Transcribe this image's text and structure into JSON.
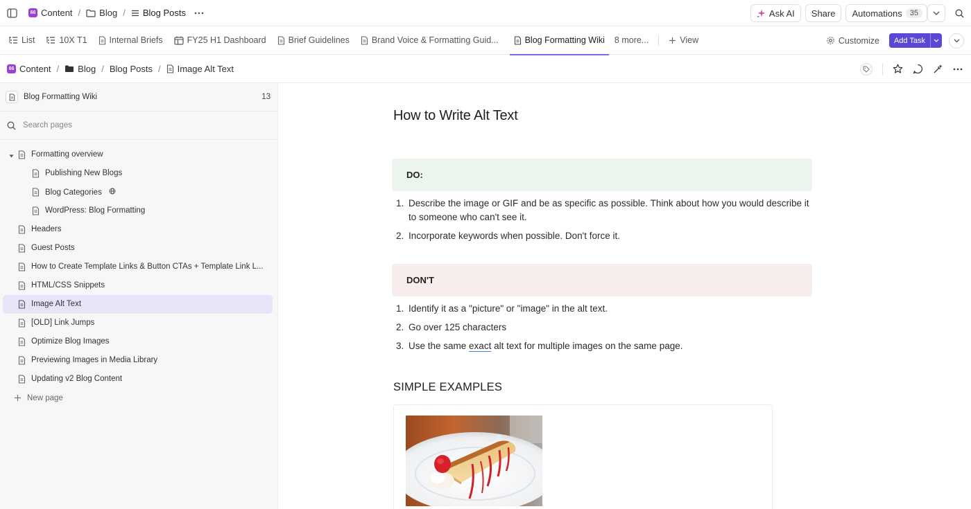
{
  "topbar": {
    "breadcrumb": [
      {
        "label": "Content",
        "icon": "workspace-badge"
      },
      {
        "label": "Blog",
        "icon": "folder-icon"
      },
      {
        "label": "Blog Posts",
        "icon": "list-icon"
      }
    ],
    "ask_ai": "Ask AI",
    "share": "Share",
    "automations": "Automations",
    "automations_count": "35"
  },
  "views": {
    "tabs": [
      {
        "label": "List",
        "icon": "list-view-icon"
      },
      {
        "label": "10X T1",
        "icon": "list-view-icon"
      },
      {
        "label": "Internal Briefs",
        "icon": "doc-icon"
      },
      {
        "label": "FY25 H1 Dashboard",
        "icon": "dashboard-icon"
      },
      {
        "label": "Brief Guidelines",
        "icon": "doc-icon"
      },
      {
        "label": "Brand Voice & Formatting Guid...",
        "icon": "doc-icon"
      },
      {
        "label": "Blog Formatting Wiki",
        "icon": "doc-icon",
        "active": true
      }
    ],
    "more": "8 more...",
    "add_view": "View",
    "customize": "Customize",
    "add_task": "Add Task"
  },
  "page_breadcrumb": {
    "workspace": "Content",
    "folder": "Blog",
    "list": "Blog Posts",
    "page": "Image Alt Text"
  },
  "sidebar": {
    "title": "Blog Formatting Wiki",
    "count": "13",
    "search_placeholder": "Search pages",
    "items": [
      {
        "label": "Formatting overview",
        "level": 0,
        "expanded": true
      },
      {
        "label": "Publishing New Blogs",
        "level": 1
      },
      {
        "label": "Blog Categories",
        "level": 1,
        "globe": true
      },
      {
        "label": "WordPress: Blog Formatting",
        "level": 1
      },
      {
        "label": "Headers",
        "level": 0
      },
      {
        "label": "Guest Posts",
        "level": 0
      },
      {
        "label": "How to Create Template Links & Button CTAs + Template Link L...",
        "level": 0
      },
      {
        "label": "HTML/CSS Snippets",
        "level": 0
      },
      {
        "label": "Image Alt Text",
        "level": 0,
        "active": true
      },
      {
        "label": "[OLD] Link Jumps",
        "level": 0
      },
      {
        "label": "Optimize Blog Images",
        "level": 0
      },
      {
        "label": "Previewing Images in Media Library",
        "level": 0
      },
      {
        "label": "Updating v2 Blog Content",
        "level": 0
      }
    ],
    "new_page": "New page"
  },
  "doc": {
    "title": "How to Write Alt Text",
    "do_heading": "DO:",
    "do_items": [
      {
        "num": "1.",
        "text": "Describe the image or GIF and be as specific as possible. Think about how you would describe it to someone who can't see it."
      },
      {
        "num": "2.",
        "text": "Incorporate keywords when possible. Don't force it."
      }
    ],
    "dont_heading": "DON'T",
    "dont_items": [
      {
        "num": "1.",
        "text": "Identify it as a \"picture\" or \"image\" in the alt text."
      },
      {
        "num": "2.",
        "text": "Go over 125 characters"
      },
      {
        "num": "3.",
        "pre": "Use the same ",
        "underlined": "exact",
        "post": " alt text for multiple images on the same page."
      }
    ],
    "examples_heading": "SIMPLE EXAMPLES"
  },
  "colors": {
    "accent": "#7b68ee",
    "add_task_bg": "#5b47d6",
    "do_bg": "#ecf4ee",
    "dont_bg": "#f8eded",
    "sidebar_bg": "#f7f7f7",
    "sidebar_active": "#e7e4f8",
    "workspace_badge": "#9b3fd9"
  }
}
